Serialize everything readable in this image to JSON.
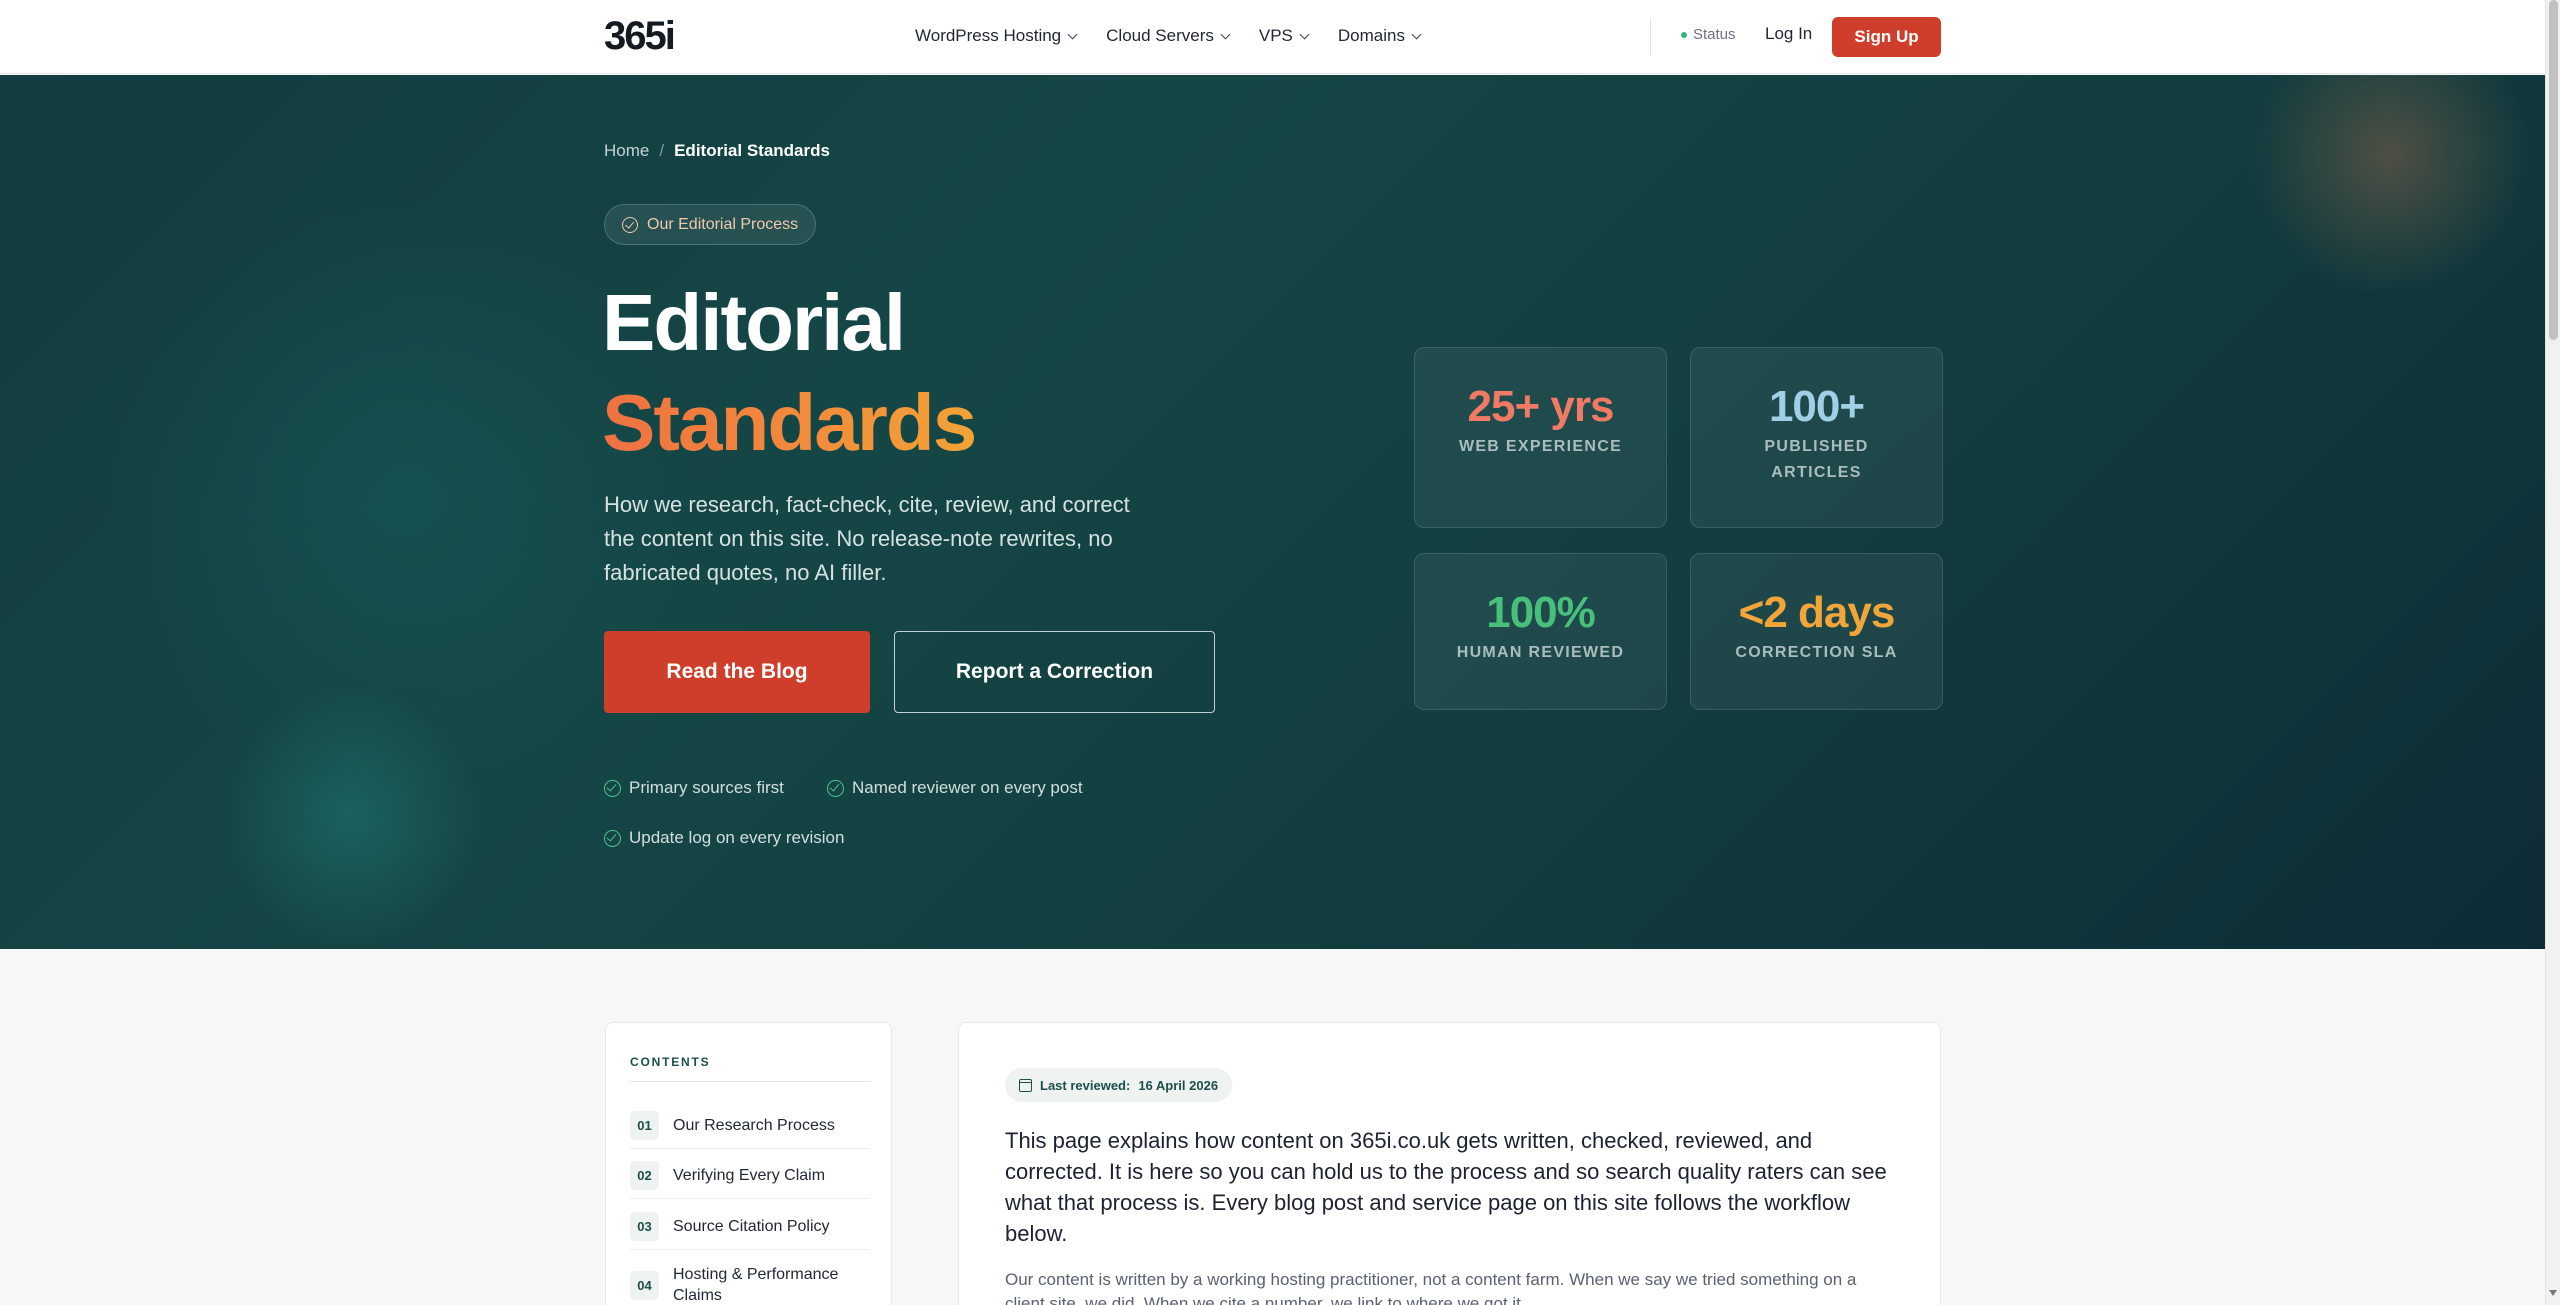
{
  "nav": {
    "logo": "365i",
    "menu": [
      {
        "label": "WordPress Hosting"
      },
      {
        "label": "Cloud Servers"
      },
      {
        "label": "VPS"
      },
      {
        "label": "Domains"
      }
    ],
    "status_label": "Status",
    "login_label": "Log In",
    "signup_label": "Sign Up",
    "accent_color": "#cf3e2a"
  },
  "hero": {
    "breadcrumb": {
      "home": "Home",
      "separator": "/",
      "current": "Editorial Standards"
    },
    "pill_label": "Our Editorial Process",
    "title_line1": "Editorial",
    "title_line2": "Standards",
    "lede": "How we research, fact-check, cite, review, and correct the content on this site. No release-note rewrites, no fabricated quotes, no AI filler.",
    "primary_button": "Read the Blog",
    "secondary_button": "Report a Correction",
    "checks": [
      "Primary sources first",
      "Named reviewer on every post",
      "Update log on every revision"
    ],
    "stats": [
      {
        "value": "25+ yrs",
        "label": "WEB EXPERIENCE",
        "color": "#f07a63"
      },
      {
        "value": "100+",
        "label": "PUBLISHED ARTICLES",
        "color": "#9fd0e6"
      },
      {
        "value": "100%",
        "label": "HUMAN REVIEWED",
        "color": "#46c07a"
      },
      {
        "value": "<2 days",
        "label": "CORRECTION SLA",
        "color": "#f2a63a"
      }
    ]
  },
  "toc": {
    "heading": "CONTENTS",
    "items": [
      {
        "num": "01",
        "label": "Our Research Process"
      },
      {
        "num": "02",
        "label": "Verifying Every Claim"
      },
      {
        "num": "03",
        "label": "Source Citation Policy"
      },
      {
        "num": "04",
        "label": "Hosting & Performance Claims"
      }
    ]
  },
  "article": {
    "reviewed_label": "Last reviewed:",
    "reviewed_date": "16 April 2026",
    "intro": "This page explains how content on 365i.co.uk gets written, checked, reviewed, and corrected. It is here so you can hold us to the process and so search quality raters can see what that process is. Every blog post and service page on this site follows the workflow below.",
    "body": "Our content is written by a working hosting practitioner, not a content farm. When we say we tried something on a client site, we did. When we cite a number, we link to where we got it."
  }
}
